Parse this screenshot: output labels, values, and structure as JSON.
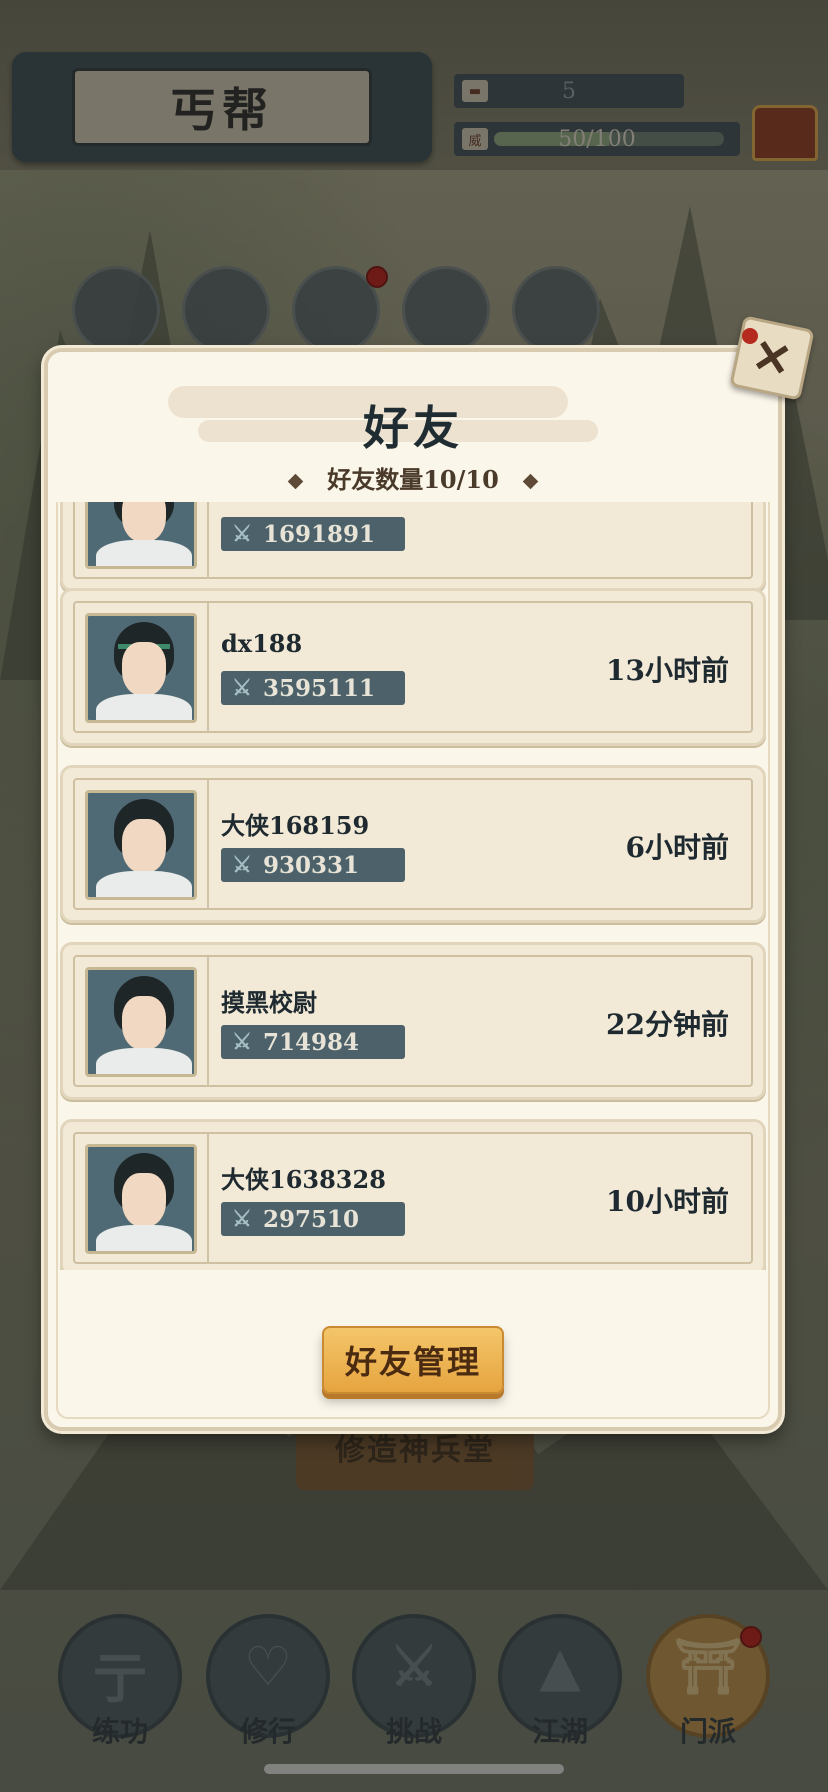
{
  "header": {
    "title": "丐帮",
    "currency_value": "5",
    "prestige_label": "威",
    "prestige_text": "50/100",
    "prestige_fraction": 0.5
  },
  "menu": {
    "temple_button": "修造神兵堂"
  },
  "modal": {
    "title": "好友",
    "friend_count": "好友数量10/10",
    "close_symbol": "✕",
    "manage_button": "好友管理"
  },
  "friends": [
    {
      "name": "",
      "power": "1691891",
      "last_online": ""
    },
    {
      "name": "dx188",
      "power": "3595111",
      "last_online": "13小时前"
    },
    {
      "name": "大侠168159",
      "power": "930331",
      "last_online": "6小时前"
    },
    {
      "name": "摸黑校尉",
      "power": "714984",
      "last_online": "22分钟前"
    },
    {
      "name": "大侠1638328",
      "power": "297510",
      "last_online": "10小时前"
    }
  ],
  "bottom_nav": [
    {
      "label": "练功",
      "icon": "martial-arts-icon"
    },
    {
      "label": "修行",
      "icon": "heart-icon"
    },
    {
      "label": "挑战",
      "icon": "crossed-swords-icon"
    },
    {
      "label": "江湖",
      "icon": "mountain-icon"
    },
    {
      "label": "门派",
      "icon": "gate-icon",
      "active": true
    }
  ],
  "colors": {
    "accent_gold": "#e6a43f",
    "panel_bg": "#fbf6ea",
    "power_badge": "#4c6169",
    "notification_red": "#b51e1a"
  }
}
